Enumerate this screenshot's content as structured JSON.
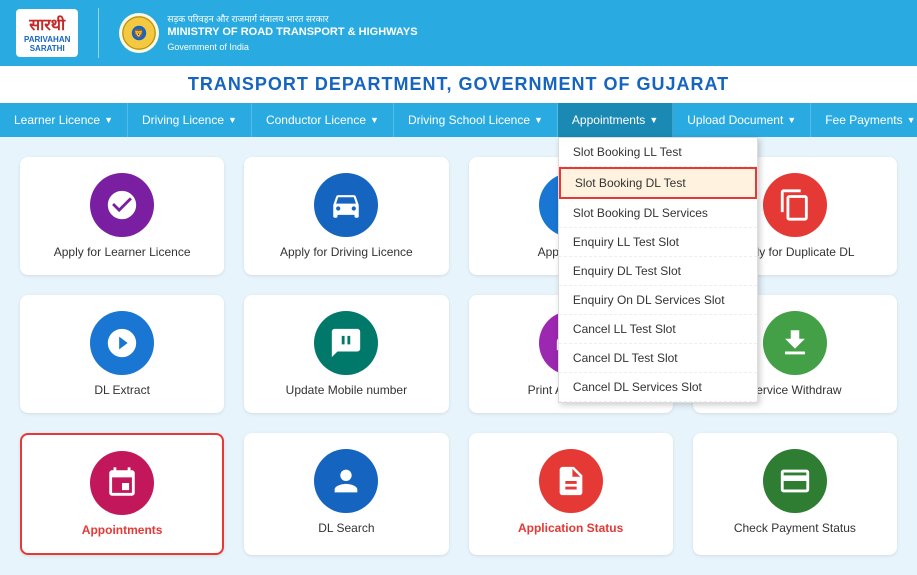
{
  "header": {
    "logo_name1": "सारथी",
    "logo_name2": "PARIVAHAN",
    "logo_name3": "SARATHI",
    "ministry_line1": "सड़क परिवहन और राजमार्ग मंत्रालय भारत सरकार",
    "ministry_line2": "MINISTRY OF ROAD TRANSPORT & HIGHWAYS",
    "ministry_line3": "Government of India"
  },
  "title": "TRANSPORT DEPARTMENT, GOVERNMENT OF GUJARAT",
  "nav": {
    "items": [
      {
        "id": "learner",
        "label": "Learner Licence",
        "hasArrow": true
      },
      {
        "id": "driving",
        "label": "Driving Licence",
        "hasArrow": true
      },
      {
        "id": "conductor",
        "label": "Conductor Licence",
        "hasArrow": true
      },
      {
        "id": "school",
        "label": "Driving School Licence",
        "hasArrow": true
      },
      {
        "id": "appointments",
        "label": "Appointments",
        "hasArrow": true,
        "active": true
      },
      {
        "id": "upload",
        "label": "Upload Document",
        "hasArrow": true
      },
      {
        "id": "fee",
        "label": "Fee Payments",
        "hasArrow": true
      }
    ]
  },
  "dropdown": {
    "items": [
      {
        "label": "Slot Booking LL Test",
        "highlighted": false
      },
      {
        "label": "Slot Booking DL Test",
        "highlighted": true
      },
      {
        "label": "Slot Booking DL Services",
        "highlighted": false
      },
      {
        "label": "Enquiry LL Test Slot",
        "highlighted": false
      },
      {
        "label": "Enquiry DL Test Slot",
        "highlighted": false
      },
      {
        "label": "Enquiry On DL Services Slot",
        "highlighted": false
      },
      {
        "label": "Cancel LL Test Slot",
        "highlighted": false
      },
      {
        "label": "Cancel DL Test Slot",
        "highlighted": false
      },
      {
        "label": "Cancel DL Services Slot",
        "highlighted": false
      }
    ]
  },
  "cards": [
    {
      "id": "apply-ll",
      "label": "Apply for Learner Licence",
      "icon": "ll",
      "color": "purple",
      "highlighted": false
    },
    {
      "id": "apply-dl",
      "label": "Apply for Driving Licence",
      "icon": "dl",
      "color": "blue-dark",
      "highlighted": false
    },
    {
      "id": "apply-dl2",
      "label": "Apply for DL",
      "icon": "dl2",
      "color": "blue",
      "highlighted": false
    },
    {
      "id": "apply-dup-dl",
      "label": "Apply for Duplicate DL",
      "icon": "dup",
      "color": "red",
      "highlighted": false
    },
    {
      "id": "dl-extract",
      "label": "DL Extract",
      "icon": "extract",
      "color": "blue",
      "highlighted": false
    },
    {
      "id": "update-mobile",
      "label": "Update Mobile number",
      "icon": "mobile",
      "color": "teal",
      "highlighted": false
    },
    {
      "id": "print-app",
      "label": "Print Application",
      "icon": "print",
      "color": "pink-dark",
      "highlighted": false
    },
    {
      "id": "service-withdraw",
      "label": "Service Withdraw",
      "icon": "withdraw",
      "color": "green",
      "highlighted": false
    },
    {
      "id": "appointments",
      "label": "Appointments",
      "icon": "appt",
      "color": "pink",
      "highlighted": true
    },
    {
      "id": "dl-search",
      "label": "DL Search",
      "icon": "search",
      "color": "blue-dark",
      "highlighted": false
    },
    {
      "id": "app-status",
      "label": "Application Status",
      "icon": "status",
      "color": "red",
      "highlighted": false
    },
    {
      "id": "payment-status",
      "label": "Check Payment Status",
      "icon": "payment",
      "color": "green2",
      "highlighted": false
    }
  ]
}
